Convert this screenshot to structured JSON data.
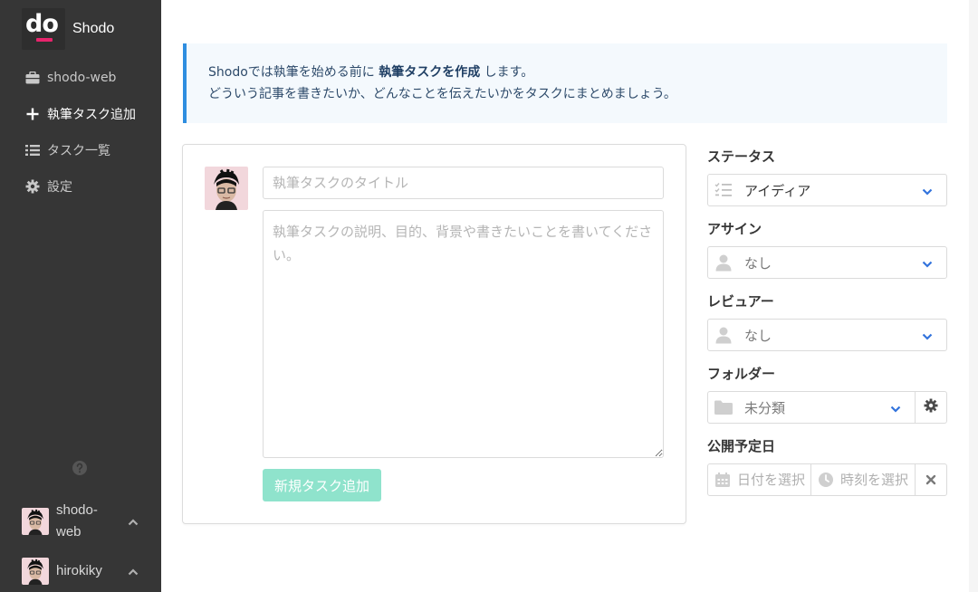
{
  "app": {
    "logo_text": "do",
    "brand": "Shodo"
  },
  "sidebar": {
    "items": [
      {
        "label": "shodo-web",
        "icon": "briefcase-icon"
      },
      {
        "label": "執筆タスク追加",
        "icon": "plus-icon"
      },
      {
        "label": "タスク一覧",
        "icon": "list-icon"
      },
      {
        "label": "設定",
        "icon": "gear-icon"
      }
    ],
    "org_user": "shodo-\nweb",
    "user": "hirokiky"
  },
  "notice": {
    "line1_before": "Shodoでは執筆を始める前に ",
    "line1_bold": "執筆タスクを作成",
    "line1_after": " します。",
    "line2": "どういう記事を書きたいか、どんなことを伝えたいかをタスクにまとめましょう。"
  },
  "form": {
    "title_placeholder": "執筆タスクのタイトル",
    "desc_placeholder": "執筆タスクの説明、目的、背景や書きたいことを書いてください。",
    "submit_label": "新規タスク追加"
  },
  "panel": {
    "status_label": "ステータス",
    "status_value": "アイディア",
    "assign_label": "アサイン",
    "assign_value": "なし",
    "reviewer_label": "レビュアー",
    "reviewer_value": "なし",
    "folder_label": "フォルダー",
    "folder_value": "未分類",
    "publish_label": "公開予定日",
    "date_placeholder": "日付を選択",
    "time_placeholder": "時刻を選択"
  },
  "colors": {
    "sidebar_bg": "#363636",
    "accent_pink": "#e8246c",
    "notice_border": "#2f8ee0",
    "button_bg": "#8fe3cc",
    "chevron_blue": "#3273dc"
  }
}
